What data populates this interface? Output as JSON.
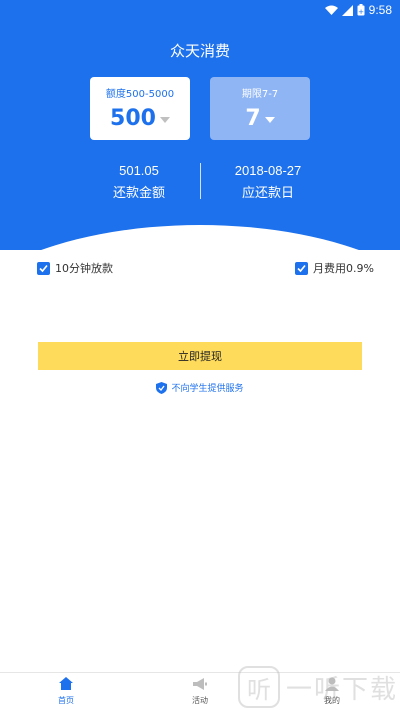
{
  "status_bar": {
    "time": "9:58"
  },
  "header": {
    "title": "众天消费"
  },
  "cards": {
    "amount": {
      "label": "额度500-5000",
      "value": "500"
    },
    "period": {
      "label": "期限7-7",
      "value": "7"
    }
  },
  "stats": {
    "repay_amount": {
      "value": "501.05",
      "label": "还款金额"
    },
    "due_date": {
      "value": "2018-08-27",
      "label": "应还款日"
    }
  },
  "options": {
    "fast_loan": {
      "label": "10分钟放款",
      "checked": true
    },
    "monthly_fee": {
      "label": "月费用0.9%",
      "checked": true
    }
  },
  "withdraw_button": {
    "label": "立即提现"
  },
  "notice": {
    "text": "不向学生提供服务"
  },
  "tabs": [
    {
      "label": "首页",
      "icon": "home-icon",
      "active": true
    },
    {
      "label": "活动",
      "icon": "megaphone-icon",
      "active": false
    },
    {
      "label": "我的",
      "icon": "user-icon",
      "active": false
    }
  ],
  "watermark": {
    "text": "一听下载"
  },
  "colors": {
    "primary": "#1e71ec",
    "button": "#ffdb5c"
  }
}
